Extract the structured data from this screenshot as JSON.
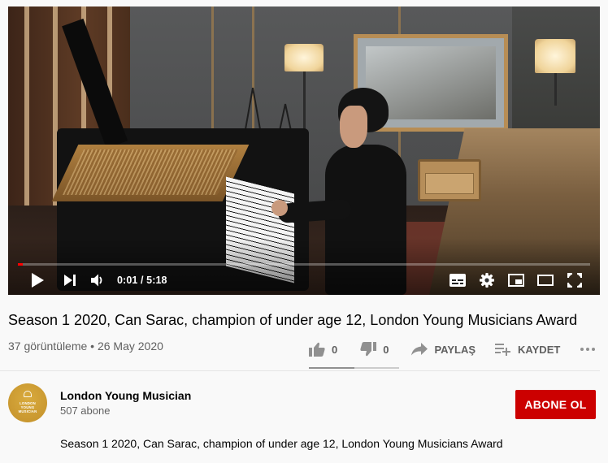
{
  "player": {
    "current_time": "0:01",
    "duration": "5:18",
    "time_display": "0:01 / 5:18",
    "progress_fraction": 0.003,
    "progress_color": "#ff0000",
    "icons": [
      "play-icon",
      "next-icon",
      "volume-icon",
      "subtitles-icon",
      "settings-icon",
      "miniplayer-icon",
      "theater-icon",
      "fullscreen-icon"
    ]
  },
  "video": {
    "title": "Season 1 2020, Can Sarac, champion of under age 12, London Young Musicians Award",
    "meta": "37 görüntüleme • 26 May 2020"
  },
  "actions": {
    "like_count": "0",
    "dislike_count": "0",
    "share_label": "PAYLAŞ",
    "save_label": "KAYDET"
  },
  "channel": {
    "name": "London Young Musician",
    "subscribers": "507 abone",
    "avatar_text": "LONDON YOUNG MUSICIAN",
    "avatar_color": "#c99a30"
  },
  "subscribe": {
    "label": "ABONE OL",
    "color": "#cc0000"
  },
  "description": {
    "text": "Season 1 2020, Can Sarac, champion of under age 12, London Young Musicians Award"
  }
}
